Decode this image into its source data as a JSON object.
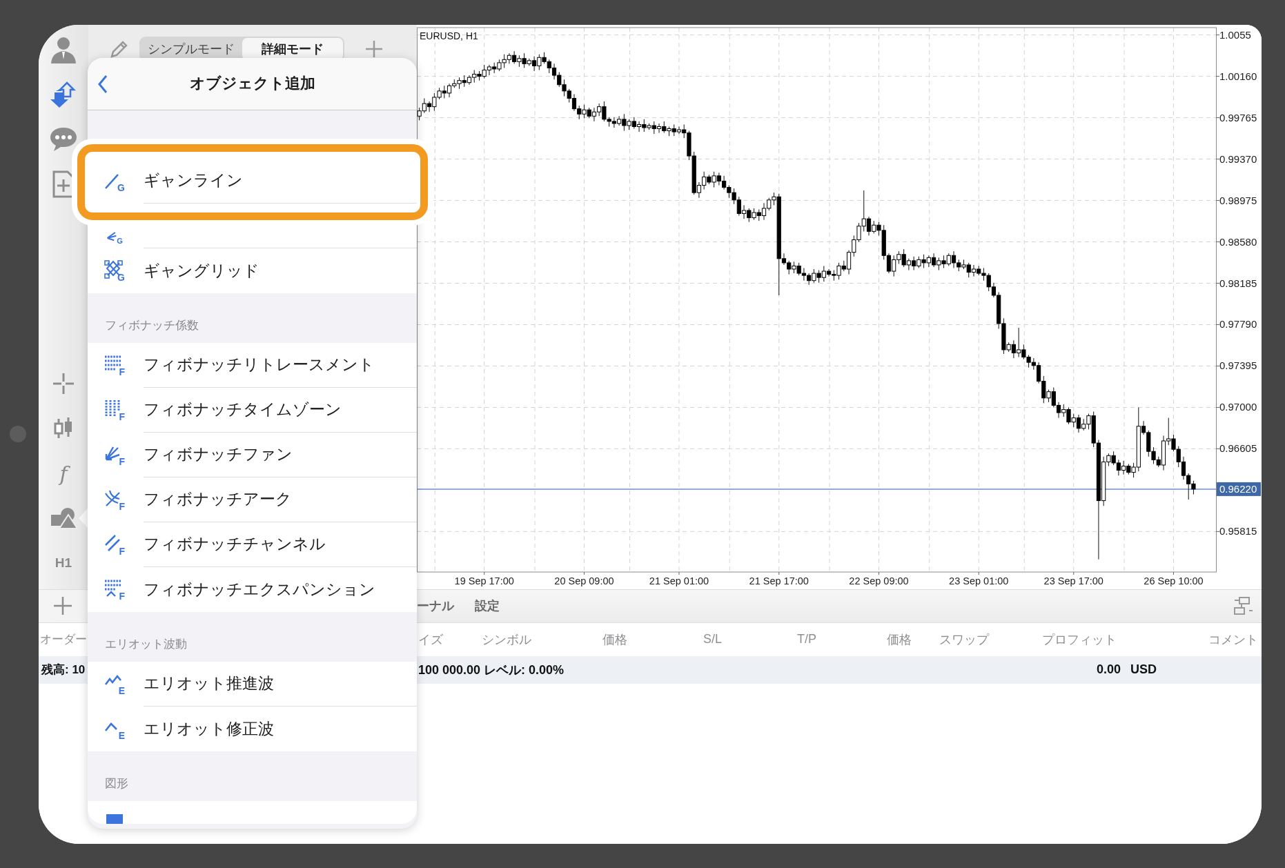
{
  "toolbar": {
    "indicator_symbol": "f",
    "timeframe": "H1"
  },
  "mode_tabs": [
    {
      "label": "シンプルモード",
      "selected": false
    },
    {
      "label": "詳細モード",
      "selected": true
    }
  ],
  "chart": {
    "chart_data": {
      "type": "candlestick",
      "title": "EURUSD, H1",
      "grid": true,
      "ylim": [
        0.95429,
        1.00625
      ],
      "categories": [
        null,
        null,
        null,
        null,
        null,
        null,
        null,
        null,
        null,
        null,
        null,
        null,
        null,
        "19 Sep 17:00",
        null,
        null,
        null,
        null,
        null,
        null,
        null,
        null,
        null,
        null,
        null,
        null,
        null,
        null,
        null,
        null,
        null,
        null,
        null,
        "20 Sep 09:00",
        null,
        null,
        null,
        null,
        null,
        null,
        null,
        null,
        null,
        null,
        null,
        null,
        null,
        null,
        null,
        null,
        null,
        null,
        "21 Sep 01:00",
        null,
        null,
        null,
        null,
        null,
        null,
        null,
        null,
        null,
        null,
        null,
        null,
        null,
        null,
        null,
        null,
        null,
        null,
        null,
        "21 Sep 17:00",
        null,
        null,
        null,
        null,
        null,
        null,
        null,
        null,
        null,
        null,
        null,
        null,
        null,
        null,
        null,
        null,
        null,
        null,
        null,
        "22 Sep 09:00",
        null,
        null,
        null,
        null,
        null,
        null,
        null,
        null,
        null,
        null,
        null,
        null,
        null,
        null,
        null,
        null,
        null,
        null,
        null,
        "23 Sep 01:00",
        null,
        null,
        null,
        null,
        null,
        null,
        null,
        null,
        null,
        null,
        null,
        null,
        null,
        null,
        null,
        null,
        null,
        null,
        "23 Sep 17:00",
        null,
        null,
        null,
        null,
        null,
        null,
        null,
        null,
        null,
        null,
        null,
        null,
        null,
        null,
        null,
        null,
        null,
        null,
        null,
        "26 Sep 10:00",
        null,
        null,
        null,
        null,
        null,
        null,
        null,
        null
      ],
      "yticks": [
        {
          "value": 1.00555,
          "label": "1.0055"
        },
        {
          "value": 1.0016,
          "label": "1.00160"
        },
        {
          "value": 0.99765,
          "label": "0.99765"
        },
        {
          "value": 0.9937,
          "label": "0.99370"
        },
        {
          "value": 0.98975,
          "label": "0.98975"
        },
        {
          "value": 0.9858,
          "label": "0.98580"
        },
        {
          "value": 0.98185,
          "label": "0.98185"
        },
        {
          "value": 0.9779,
          "label": "0.97790"
        },
        {
          "value": 0.97395,
          "label": "0.97395"
        },
        {
          "value": 0.97,
          "label": "0.97000"
        },
        {
          "value": 0.96605,
          "label": "0.96605"
        },
        {
          "value": 0.95815,
          "label": "0.95815"
        }
      ],
      "ref_lines": [
        {
          "axis": "y",
          "value": 0.9622,
          "label": "0.96220"
        }
      ],
      "ohlc": [
        [
          0.9978,
          0.9986,
          0.9974,
          0.9983
        ],
        [
          0.9983,
          0.9995,
          0.9981,
          0.999
        ],
        [
          0.999,
          0.9992,
          0.9982,
          0.9987
        ],
        [
          0.9987,
          1.0,
          0.9983,
          0.9996
        ],
        [
          0.9996,
          1.0005,
          0.9994,
          1.0002
        ],
        [
          1.0002,
          1.0007,
          0.9995,
          1.0
        ],
        [
          1.0,
          1.0009,
          0.9996,
          1.0007
        ],
        [
          1.0007,
          1.0013,
          1.0005,
          1.0009
        ],
        [
          1.0009,
          1.0015,
          1.0004,
          1.0012
        ],
        [
          1.0012,
          1.0017,
          1.0006,
          1.001
        ],
        [
          1.001,
          1.0017,
          1.0008,
          1.0015
        ],
        [
          1.0015,
          1.0022,
          1.001,
          1.0018
        ],
        [
          1.0018,
          1.0021,
          1.0012,
          1.0016
        ],
        [
          1.0016,
          1.0027,
          1.0014,
          1.0022
        ],
        [
          1.0022,
          1.0027,
          1.0017,
          1.0025
        ],
        [
          1.0025,
          1.0029,
          1.0019,
          1.0023
        ],
        [
          1.0023,
          1.0032,
          1.0021,
          1.0029
        ],
        [
          1.0029,
          1.0037,
          1.0024,
          1.0032
        ],
        [
          1.0032,
          1.0038,
          1.0028,
          1.0036
        ],
        [
          1.0036,
          1.004,
          1.0028,
          1.003
        ],
        [
          1.003,
          1.0036,
          1.0025,
          1.0033
        ],
        [
          1.0033,
          1.0038,
          1.0024,
          1.0028
        ],
        [
          1.0028,
          1.0033,
          1.0026,
          1.0031
        ],
        [
          1.0031,
          1.0035,
          1.0021,
          1.0026
        ],
        [
          1.0026,
          1.0037,
          1.0022,
          1.0034
        ],
        [
          1.0034,
          1.0039,
          1.0028,
          1.003
        ],
        [
          1.003,
          1.0032,
          1.0019,
          1.0024
        ],
        [
          1.0024,
          1.0028,
          1.0013,
          1.0017
        ],
        [
          1.0017,
          1.002,
          1.0006,
          1.0008
        ],
        [
          1.0008,
          1.0013,
          0.9997,
          1.0002
        ],
        [
          1.0002,
          1.0004,
          0.9991,
          0.9995
        ],
        [
          0.9995,
          0.9999,
          0.9983,
          0.9985
        ],
        [
          0.9985,
          0.9988,
          0.9975,
          0.998
        ],
        [
          0.998,
          0.9989,
          0.9976,
          0.9984
        ],
        [
          0.9984,
          0.9986,
          0.9976,
          0.9978
        ],
        [
          0.9978,
          0.9986,
          0.9973,
          0.9982
        ],
        [
          0.9982,
          0.999,
          0.9978,
          0.9987
        ],
        [
          0.9987,
          0.9992,
          0.9973,
          0.9975
        ],
        [
          0.9975,
          0.9977,
          0.9968,
          0.9973
        ],
        [
          0.9973,
          0.9977,
          0.9967,
          0.9971
        ],
        [
          0.9971,
          0.9978,
          0.9969,
          0.9975
        ],
        [
          0.9975,
          0.998,
          0.9964,
          0.9969
        ],
        [
          0.9969,
          0.9975,
          0.9965,
          0.9973
        ],
        [
          0.9973,
          0.9977,
          0.9966,
          0.9968
        ],
        [
          0.9968,
          0.9973,
          0.9963,
          0.997
        ],
        [
          0.997,
          0.9975,
          0.9963,
          0.9967
        ],
        [
          0.9967,
          0.9971,
          0.9965,
          0.9969
        ],
        [
          0.9969,
          0.9973,
          0.9961,
          0.9966
        ],
        [
          0.9966,
          0.9971,
          0.9962,
          0.9968
        ],
        [
          0.9968,
          0.9973,
          0.9962,
          0.9964
        ],
        [
          0.9964,
          0.9968,
          0.9959,
          0.9966
        ],
        [
          0.9966,
          0.997,
          0.9959,
          0.9963
        ],
        [
          0.9963,
          0.9968,
          0.9961,
          0.9965
        ],
        [
          0.9965,
          0.997,
          0.9957,
          0.9962
        ],
        [
          0.9962,
          0.9964,
          0.9936,
          0.994
        ],
        [
          0.994,
          0.9944,
          0.9903,
          0.9905
        ],
        [
          0.9905,
          0.9915,
          0.99,
          0.9912
        ],
        [
          0.9912,
          0.9925,
          0.9908,
          0.992
        ],
        [
          0.992,
          0.9922,
          0.9913,
          0.9915
        ],
        [
          0.9915,
          0.9925,
          0.991,
          0.9921
        ],
        [
          0.9921,
          0.9924,
          0.9912,
          0.9916
        ],
        [
          0.9916,
          0.9921,
          0.9908,
          0.991
        ],
        [
          0.991,
          0.9912,
          0.99,
          0.9905
        ],
        [
          0.9905,
          0.9909,
          0.9894,
          0.9898
        ],
        [
          0.9898,
          0.9901,
          0.9883,
          0.9885
        ],
        [
          0.9885,
          0.9893,
          0.988,
          0.9888
        ],
        [
          0.9888,
          0.989,
          0.9877,
          0.9881
        ],
        [
          0.9881,
          0.989,
          0.9879,
          0.9886
        ],
        [
          0.9886,
          0.9889,
          0.9878,
          0.9883
        ],
        [
          0.9883,
          0.9895,
          0.9879,
          0.989
        ],
        [
          0.989,
          0.99,
          0.9888,
          0.9898
        ],
        [
          0.9898,
          0.9905,
          0.9893,
          0.9901
        ],
        [
          0.9901,
          0.9904,
          0.9807,
          0.9842
        ],
        [
          0.9842,
          0.9847,
          0.9836,
          0.9838
        ],
        [
          0.9838,
          0.984,
          0.9827,
          0.9832
        ],
        [
          0.9832,
          0.9839,
          0.9828,
          0.9835
        ],
        [
          0.9835,
          0.9838,
          0.9826,
          0.9828
        ],
        [
          0.9828,
          0.9833,
          0.9821,
          0.9826
        ],
        [
          0.9826,
          0.9828,
          0.9817,
          0.9821
        ],
        [
          0.9821,
          0.9832,
          0.9819,
          0.9828
        ],
        [
          0.9828,
          0.9831,
          0.9819,
          0.9824
        ],
        [
          0.9824,
          0.9835,
          0.982,
          0.983
        ],
        [
          0.983,
          0.9832,
          0.9825,
          0.9827
        ],
        [
          0.9827,
          0.9831,
          0.9821,
          0.9826
        ],
        [
          0.9826,
          0.9838,
          0.9822,
          0.9835
        ],
        [
          0.9835,
          0.984,
          0.983,
          0.9832
        ],
        [
          0.9832,
          0.985,
          0.9827,
          0.9848
        ],
        [
          0.9848,
          0.9864,
          0.9844,
          0.986
        ],
        [
          0.986,
          0.9876,
          0.9858,
          0.9873
        ],
        [
          0.9873,
          0.9907,
          0.9868,
          0.988
        ],
        [
          0.988,
          0.9882,
          0.9864,
          0.9868
        ],
        [
          0.9868,
          0.9878,
          0.9866,
          0.9874
        ],
        [
          0.9874,
          0.9877,
          0.9864,
          0.9869
        ],
        [
          0.9869,
          0.9874,
          0.9841,
          0.9845
        ],
        [
          0.9845,
          0.9847,
          0.9828,
          0.983
        ],
        [
          0.983,
          0.9845,
          0.9825,
          0.9841
        ],
        [
          0.9841,
          0.9849,
          0.9837,
          0.9846
        ],
        [
          0.9846,
          0.9851,
          0.9834,
          0.9836
        ],
        [
          0.9836,
          0.9842,
          0.9831,
          0.984
        ],
        [
          0.984,
          0.9844,
          0.9831,
          0.9835
        ],
        [
          0.9835,
          0.9844,
          0.9833,
          0.9841
        ],
        [
          0.9841,
          0.9846,
          0.9833,
          0.9838
        ],
        [
          0.9838,
          0.9845,
          0.9834,
          0.9843
        ],
        [
          0.9843,
          0.9847,
          0.9834,
          0.9836
        ],
        [
          0.9836,
          0.9843,
          0.9831,
          0.984
        ],
        [
          0.984,
          0.9845,
          0.9833,
          0.9837
        ],
        [
          0.9837,
          0.9847,
          0.9835,
          0.9845
        ],
        [
          0.9845,
          0.9849,
          0.9833,
          0.9838
        ],
        [
          0.9838,
          0.9841,
          0.983,
          0.9834
        ],
        [
          0.9834,
          0.9841,
          0.9832,
          0.9836
        ],
        [
          0.9836,
          0.9838,
          0.9824,
          0.9829
        ],
        [
          0.9829,
          0.9836,
          0.9825,
          0.9832
        ],
        [
          0.9832,
          0.9835,
          0.9826,
          0.9828
        ],
        [
          0.9828,
          0.9833,
          0.9821,
          0.9826
        ],
        [
          0.9826,
          0.9828,
          0.9811,
          0.9815
        ],
        [
          0.9815,
          0.9819,
          0.9805,
          0.9807
        ],
        [
          0.9807,
          0.981,
          0.9775,
          0.978
        ],
        [
          0.978,
          0.9785,
          0.9751,
          0.9755
        ],
        [
          0.9755,
          0.9762,
          0.9753,
          0.976
        ],
        [
          0.976,
          0.9764,
          0.9747,
          0.9752
        ],
        [
          0.9752,
          0.9776,
          0.9748,
          0.9755
        ],
        [
          0.9755,
          0.976,
          0.9746,
          0.9748
        ],
        [
          0.9748,
          0.975,
          0.9738,
          0.9743
        ],
        [
          0.9743,
          0.9747,
          0.9736,
          0.974
        ],
        [
          0.974,
          0.9743,
          0.9723,
          0.9725
        ],
        [
          0.9725,
          0.973,
          0.9704,
          0.9709
        ],
        [
          0.9709,
          0.9717,
          0.9705,
          0.9715
        ],
        [
          0.9715,
          0.9719,
          0.97,
          0.9702
        ],
        [
          0.9702,
          0.9705,
          0.969,
          0.9695
        ],
        [
          0.9695,
          0.9703,
          0.9691,
          0.9698
        ],
        [
          0.9698,
          0.97,
          0.9684,
          0.9686
        ],
        [
          0.9686,
          0.9694,
          0.9681,
          0.969
        ],
        [
          0.969,
          0.9693,
          0.9676,
          0.968
        ],
        [
          0.968,
          0.9689,
          0.9678,
          0.9684
        ],
        [
          0.9684,
          0.9694,
          0.9679,
          0.9692
        ],
        [
          0.9692,
          0.9696,
          0.9662,
          0.9666
        ],
        [
          0.9666,
          0.9669,
          0.9555,
          0.9611
        ],
        [
          0.9611,
          0.9653,
          0.9606,
          0.9648
        ],
        [
          0.9648,
          0.9656,
          0.9644,
          0.9654
        ],
        [
          0.9654,
          0.9658,
          0.9645,
          0.9647
        ],
        [
          0.9647,
          0.965,
          0.9635,
          0.964
        ],
        [
          0.964,
          0.9649,
          0.9636,
          0.9644
        ],
        [
          0.9644,
          0.9646,
          0.9636,
          0.9638
        ],
        [
          0.9638,
          0.9647,
          0.9633,
          0.9643
        ],
        [
          0.9643,
          0.97,
          0.9639,
          0.9682
        ],
        [
          0.9682,
          0.9687,
          0.9674,
          0.9676
        ],
        [
          0.9676,
          0.9678,
          0.9653,
          0.9658
        ],
        [
          0.9658,
          0.9662,
          0.9646,
          0.965
        ],
        [
          0.965,
          0.9653,
          0.9643,
          0.9645
        ],
        [
          0.9645,
          0.9673,
          0.964,
          0.9668
        ],
        [
          0.9668,
          0.969,
          0.9664,
          0.967
        ],
        [
          0.967,
          0.9674,
          0.9658,
          0.966
        ],
        [
          0.966,
          0.9663,
          0.9643,
          0.9648
        ],
        [
          0.9648,
          0.9653,
          0.9631,
          0.9635
        ],
        [
          0.9635,
          0.9637,
          0.9612,
          0.9627
        ],
        [
          0.9627,
          0.963,
          0.9617,
          0.9622
        ],
        null,
        null,
        null,
        null
      ]
    }
  },
  "terminal": {
    "tabs": [
      "ーナル",
      "設定"
    ],
    "left_header": "オーダー",
    "left_balance": "残高: 10",
    "columns": [
      "イズ",
      "シンボル",
      "価格",
      "S/L",
      "T/P",
      "価格",
      "スワップ",
      "プロフィット",
      "コメント"
    ],
    "balance": "100 000.00 レベル: 0.00%",
    "profit": "0.00",
    "currency": "USD"
  },
  "popover": {
    "title": "オブジェクト追加",
    "groups": [
      {
        "items": [
          {
            "kind": "gann-line",
            "icon_letter": "G",
            "label": "ギャンライン",
            "highlighted": true
          },
          {
            "kind": "gann-fan",
            "icon_letter": "G",
            "highlighted": false
          },
          {
            "kind": "gann-grid",
            "icon_letter": "G",
            "label": "ギャングリッド",
            "highlighted": false
          }
        ]
      },
      {
        "header": "フィボナッチ係数",
        "items": [
          {
            "kind": "fib-retracement",
            "icon_letter": "F",
            "label": "フィボナッチリトレースメント",
            "highlighted": false
          },
          {
            "kind": "fib-timezones",
            "icon_letter": "F",
            "label": "フィボナッチタイムゾーン",
            "highlighted": false
          },
          {
            "kind": "fib-fan",
            "icon_letter": "F",
            "label": "フィボナッチファン",
            "highlighted": false
          },
          {
            "kind": "fib-arc",
            "icon_letter": "F",
            "label": "フィボナッチアーク",
            "highlighted": false
          },
          {
            "kind": "fib-channel",
            "icon_letter": "F",
            "label": "フィボナッチチャンネル",
            "highlighted": false
          },
          {
            "kind": "fib-expansion",
            "icon_letter": "F",
            "label": "フィボナッチエクスパンション",
            "highlighted": false
          }
        ]
      },
      {
        "header": "エリオット波動",
        "items": [
          {
            "kind": "elliott-impulse",
            "icon_letter": "E",
            "label": "エリオット推進波",
            "highlighted": false
          },
          {
            "kind": "elliott-correction",
            "icon_letter": "E",
            "label": "エリオット修正波",
            "highlighted": false
          }
        ]
      },
      {
        "header": "図形",
        "items": [
          {
            "kind": "rectangle",
            "highlighted": false
          }
        ]
      }
    ]
  }
}
